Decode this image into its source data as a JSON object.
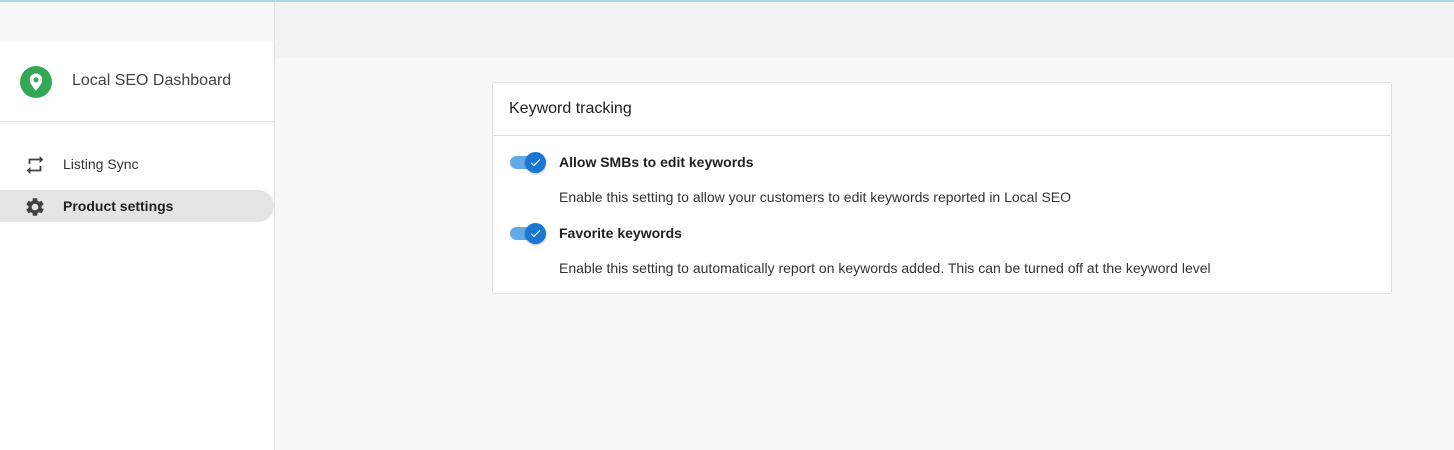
{
  "sidebar": {
    "brand_title": "Local SEO Dashboard",
    "brand_color": "#34a853",
    "items": [
      {
        "label": "Listing Sync",
        "icon": "repeat-icon",
        "active": false
      },
      {
        "label": "Product settings",
        "icon": "gear-icon",
        "active": true
      }
    ]
  },
  "card": {
    "title": "Keyword tracking",
    "settings": [
      {
        "label": "Allow SMBs to edit keywords",
        "description": "Enable this setting to allow your customers to edit keywords reported in Local SEO",
        "enabled": true
      },
      {
        "label": "Favorite keywords",
        "description": "Enable this setting to automatically report on keywords added. This can be turned off at the keyword level",
        "enabled": true
      }
    ]
  },
  "colors": {
    "accent": "#1976d2",
    "toggle_track": "#62a9e8",
    "active_nav_bg": "#e4e4e4"
  }
}
